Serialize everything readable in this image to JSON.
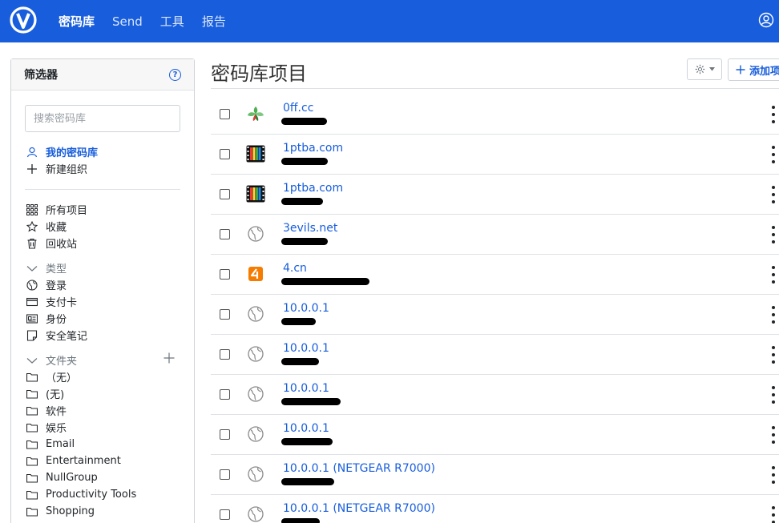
{
  "nav": {
    "items": [
      {
        "label": "密码库",
        "active": true
      },
      {
        "label": "Send",
        "active": false
      },
      {
        "label": "工具",
        "active": false
      },
      {
        "label": "报告",
        "active": false
      }
    ]
  },
  "filter": {
    "title": "筛选器",
    "help_glyph": "?",
    "search_placeholder": "搜索密码库",
    "my_vault": "我的密码库",
    "new_org": "新建组织",
    "all_items": "所有项目",
    "favorites": "收藏",
    "trash": "回收站",
    "types_label": "类型",
    "types": [
      "登录",
      "支付卡",
      "身份",
      "安全笔记"
    ],
    "folders_label": "文件夹",
    "folders": [
      "（无）",
      "(无)",
      "软件",
      "娱乐",
      "Email",
      "Entertainment",
      "NullGroup",
      "Productivity Tools",
      "Shopping"
    ]
  },
  "main": {
    "title": "密码库项目",
    "add_label": "添加项目",
    "items": [
      {
        "name": "0ff.cc",
        "icon": "leaf-site-icon"
      },
      {
        "name": "1ptba.com",
        "icon": "film-site-icon"
      },
      {
        "name": "1ptba.com",
        "icon": "film-site-icon"
      },
      {
        "name": "3evils.net",
        "icon": "globe-icon"
      },
      {
        "name": "4.cn",
        "icon": "orange-site-icon"
      },
      {
        "name": "10.0.0.1",
        "icon": "globe-icon"
      },
      {
        "name": "10.0.0.1",
        "icon": "globe-icon"
      },
      {
        "name": "10.0.0.1",
        "icon": "globe-icon"
      },
      {
        "name": "10.0.0.1",
        "icon": "globe-icon"
      },
      {
        "name": "10.0.0.1 (NETGEAR R7000)",
        "icon": "globe-icon"
      },
      {
        "name": "10.0.0.1 (NETGEAR R7000)",
        "icon": "globe-icon"
      }
    ]
  },
  "colors": {
    "brand": "#175ddc",
    "link": "#175ddc"
  }
}
